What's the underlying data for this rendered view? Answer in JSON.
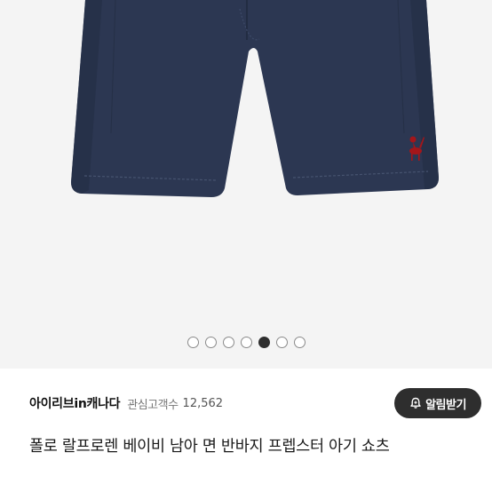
{
  "gallery": {
    "image_alt": "Navy shorts with red polo pony logo",
    "slide_count": 7,
    "active_index": 4
  },
  "seller": {
    "shop_name": "아이리브in캐나다",
    "followers_label": "관심고객수",
    "followers_count": "12,562",
    "notify_label": "알림받기"
  },
  "product": {
    "title": "폴로 랄프로렌 베이비 남아 면 반바지 프렙스터 아기 쇼츠"
  },
  "colors": {
    "gallery_bg": "#f4f4f4",
    "shorts_navy": "#2c3752",
    "logo_red": "#a4161a",
    "button_dark": "#2e2e2e"
  }
}
